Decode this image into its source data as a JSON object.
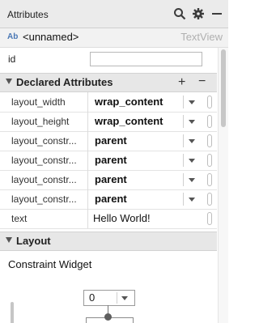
{
  "header": {
    "title": "Attributes",
    "icons": [
      "search-icon",
      "gear-icon",
      "minimize-icon"
    ]
  },
  "component": {
    "badge": "Ab",
    "name": "<unnamed>",
    "type": "TextView"
  },
  "id_field": {
    "label": "id",
    "value": ""
  },
  "declared": {
    "title": "Declared Attributes",
    "add": "+",
    "remove": "−",
    "rows": [
      {
        "name": "layout_width",
        "value": "wrap_content"
      },
      {
        "name": "layout_height",
        "value": "wrap_content"
      },
      {
        "name": "layout_constr...",
        "value": "parent"
      },
      {
        "name": "layout_constr...",
        "value": "parent"
      },
      {
        "name": "layout_constr...",
        "value": "parent"
      },
      {
        "name": "layout_constr...",
        "value": "parent"
      },
      {
        "name": "text",
        "value": "Hello World!"
      }
    ]
  },
  "layout": {
    "title": "Layout",
    "subtitle": "Constraint Widget",
    "margin_value": "0"
  }
}
